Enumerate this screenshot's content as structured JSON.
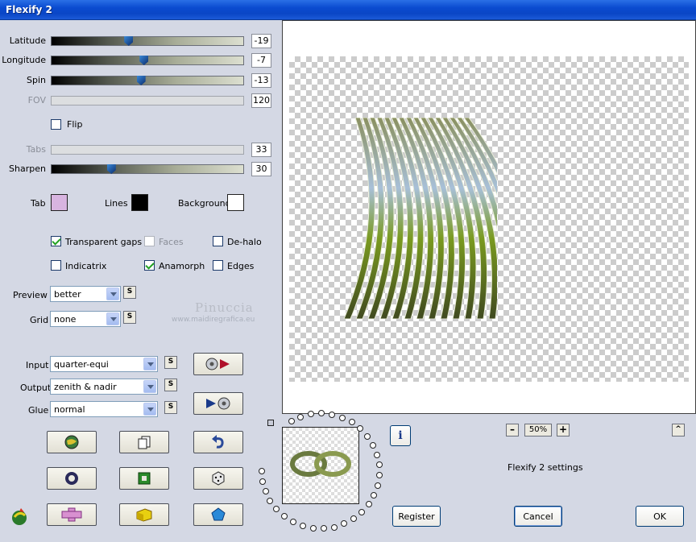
{
  "window": {
    "title": "Flexify 2"
  },
  "sliders": [
    {
      "key": "latitude",
      "label": "Latitude",
      "value": "-19",
      "fraction": 0.4,
      "disabled": false
    },
    {
      "key": "longitude",
      "label": "Longitude",
      "value": "-7",
      "fraction": 0.48,
      "disabled": false
    },
    {
      "key": "spin",
      "label": "Spin",
      "value": "-13",
      "fraction": 0.465,
      "disabled": false
    },
    {
      "key": "fov",
      "label": "FOV",
      "value": "120",
      "fraction": null,
      "disabled": true
    },
    {
      "key": "tabs",
      "label": "Tabs",
      "value": "33",
      "fraction": null,
      "disabled": true
    },
    {
      "key": "sharpen",
      "label": "Sharpen",
      "value": "30",
      "fraction": 0.31,
      "disabled": false
    }
  ],
  "flip": {
    "label": "Flip",
    "checked": false
  },
  "colors": {
    "tab": {
      "label": "Tab",
      "color": "#d8b4e0"
    },
    "lines": {
      "label": "Lines",
      "color": "#000000"
    },
    "background": {
      "label": "Background",
      "color": "#ffffff"
    }
  },
  "options": {
    "transparent_gaps": {
      "label": "Transparent gaps",
      "checked": true
    },
    "faces": {
      "label": "Faces",
      "checked": false,
      "disabled": true
    },
    "de_halo": {
      "label": "De-halo",
      "checked": false
    },
    "indicatrix": {
      "label": "Indicatrix",
      "checked": false
    },
    "anamorph": {
      "label": "Anamorph",
      "checked": true
    },
    "edges": {
      "label": "Edges",
      "checked": false
    }
  },
  "preview_quality": {
    "label": "Preview",
    "value": "better"
  },
  "grid": {
    "label": "Grid",
    "value": "none"
  },
  "input": {
    "label": "Input",
    "value": "quarter-equi"
  },
  "output": {
    "label": "Output",
    "value": "zenith & nadir"
  },
  "glue": {
    "label": "Glue",
    "value": "normal"
  },
  "s_label": "S",
  "watermark": {
    "name": "Pinuccia",
    "url": "www.maidiregrafica.eu"
  },
  "zoom": {
    "value": "50%",
    "minus": "–",
    "plus": "+",
    "collapse": "^"
  },
  "info_label": "i",
  "status": "Flexify 2 settings",
  "buttons": {
    "register": "Register",
    "cancel": "Cancel",
    "ok": "OK"
  },
  "icons": {
    "play_in": "disc-play-icon",
    "play_out": "play-disc-icon",
    "row1": [
      "globe-icon",
      "copy-page-icon",
      "undo-icon"
    ],
    "row2": [
      "ring-icon",
      "square-frame-icon",
      "dice-icon"
    ],
    "row3": [
      "plus-shape-icon",
      "cube-icon",
      "pentagon-icon"
    ],
    "logo": "flexify-logo-icon"
  }
}
